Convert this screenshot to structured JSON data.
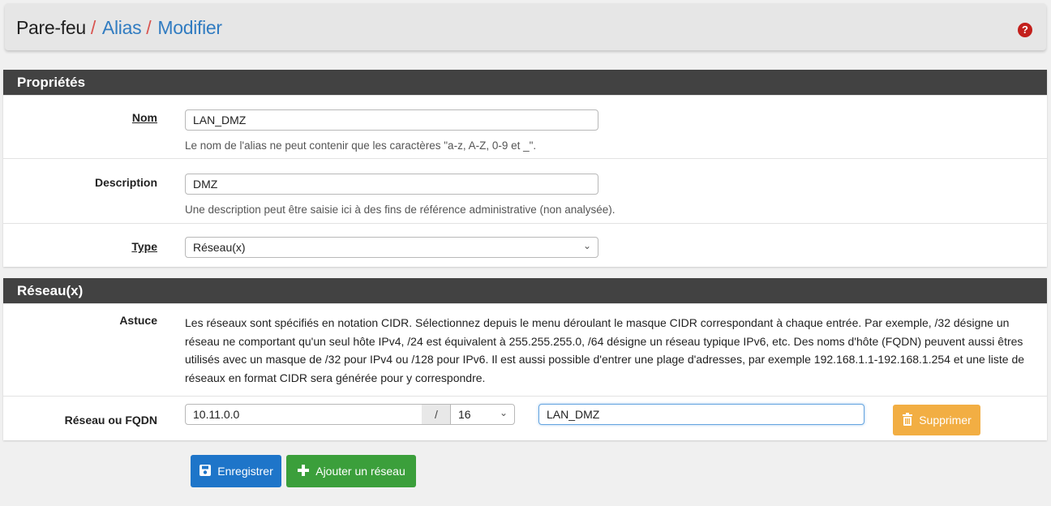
{
  "breadcrumb": {
    "item1": "Pare-feu",
    "sep": "/",
    "item2": "Alias",
    "item3": "Modifier"
  },
  "help_icon_glyph": "?",
  "properties": {
    "heading": "Propriétés",
    "name_label": "Nom",
    "name_value": "LAN_DMZ",
    "name_help": "Le nom de l'alias ne peut contenir que les caractères \"a-z, A-Z, 0-9 et _\".",
    "description_label": "Description",
    "description_value": "DMZ",
    "description_help": "Une description peut être saisie ici à des fins de référence administrative (non analysée).",
    "type_label": "Type",
    "type_value": "Réseau(x)"
  },
  "networks": {
    "heading": "Réseau(x)",
    "hint_label": "Astuce",
    "hint_text": "Les réseaux sont spécifiés en notation CIDR. Sélectionnez depuis le menu déroulant le masque CIDR correspondant à chaque entrée. Par exemple, /32 désigne un réseau ne comportant qu'un seul hôte IPv4, /24 est équivalent à 255.255.255.0, /64 désigne un réseau typique IPv6, etc. Des noms d'hôte (FQDN) peuvent aussi êtres utilisés avec un masque de /32 pour IPv4 ou /128 pour IPv6. Il est aussi possible d'entrer une plage d'adresses, par exemple 192.168.1.1-192.168.1.254 et une liste de réseaux en format CIDR sera générée pour y correspondre.",
    "entry_label": "Réseau ou FQDN",
    "address_value": "10.11.0.0",
    "slash": "/",
    "mask_value": "16",
    "entry_description_value": "LAN_DMZ",
    "delete_label": "Supprimer"
  },
  "actions": {
    "save_label": "Enregistrer",
    "add_network_label": "Ajouter un réseau"
  },
  "icons": {
    "chevron": "chevron-down-icon",
    "save": "floppy-disk-icon",
    "add": "plus-icon",
    "delete": "trash-icon",
    "help": "question-circle-icon"
  },
  "colors": {
    "link": "#317cc1",
    "separator": "#d9534f",
    "panel_heading": "#424242",
    "help_icon": "#c3201c",
    "save_button": "#1e75c9",
    "add_button": "#3b9f3b",
    "delete_button": "#f2ae43",
    "focus_border": "#66a5e0"
  }
}
